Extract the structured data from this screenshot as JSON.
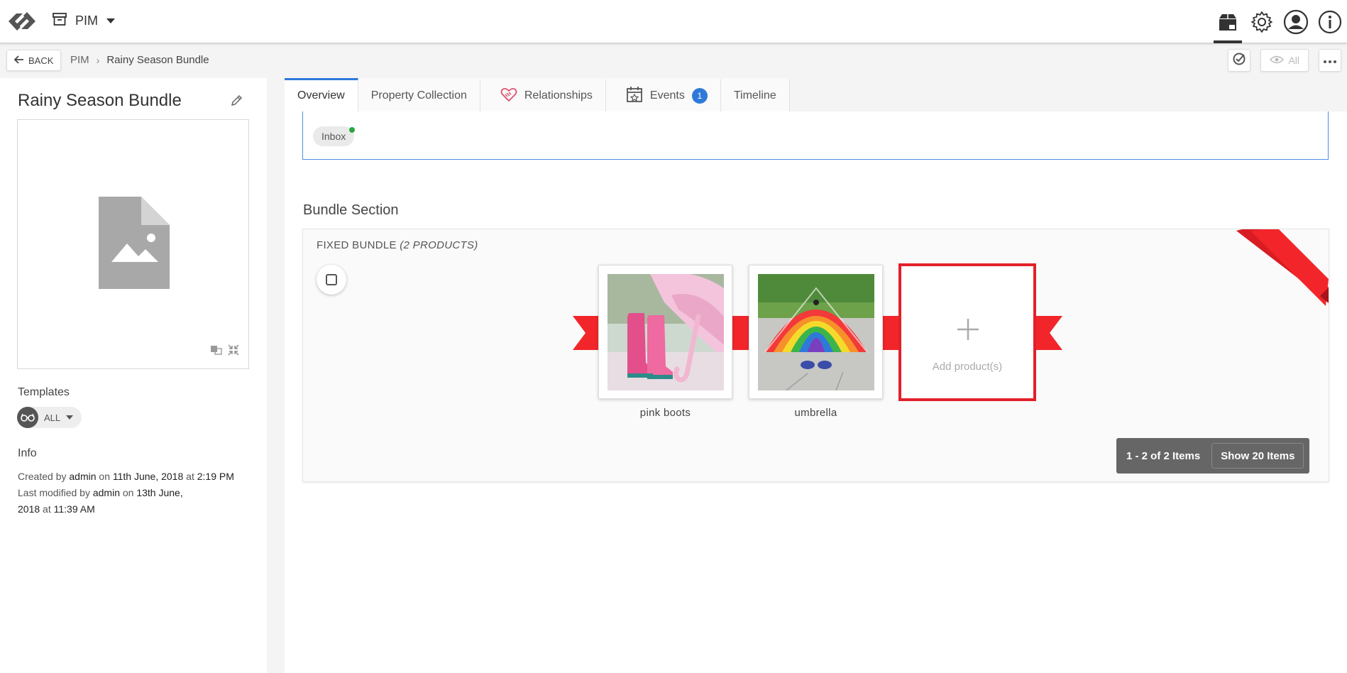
{
  "topbar": {
    "app_name": "PIM",
    "icons": [
      "logo-icon",
      "archive-icon",
      "package-icon",
      "gear-icon",
      "user-icon",
      "info-icon"
    ]
  },
  "subbar": {
    "back_label": "BACK",
    "breadcrumb": [
      "PIM",
      "Rainy Season Bundle"
    ],
    "view_label": "All"
  },
  "entity": {
    "title": "Rainy Season Bundle",
    "templates_label": "Templates",
    "template_chip": "ALL",
    "info_label": "Info",
    "created_prefix": "Created by",
    "created_by": "admin",
    "created_on": "on",
    "created_date": "11th June, 2018",
    "created_at": "at",
    "created_time": "2:19 PM",
    "modified_prefix": "Last modified by",
    "modified_by": "admin",
    "modified_on": "on",
    "modified_date": "13th June,",
    "modified_date2": "2018",
    "modified_at": "at",
    "modified_time": "11:39 AM"
  },
  "tabs": [
    {
      "label": "Overview"
    },
    {
      "label": "Property Collection"
    },
    {
      "label": "Relationships"
    },
    {
      "label": "Events",
      "badge": "1"
    },
    {
      "label": "Timeline"
    }
  ],
  "workflow": {
    "chip": "Inbox"
  },
  "bundle": {
    "section_title": "Bundle Section",
    "header": "FIXED BUNDLE",
    "count": "(2 PRODUCTS)",
    "products": [
      {
        "name": "pink boots"
      },
      {
        "name": "umbrella"
      }
    ],
    "add_label": "Add product(s)",
    "pager_text": "1 - 2 of 2 Items",
    "pager_button": "Show 20 Items"
  },
  "colors": {
    "accent": "#2f7ad9",
    "ribbon": "#f2262a",
    "status_dot": "#2ba540"
  }
}
